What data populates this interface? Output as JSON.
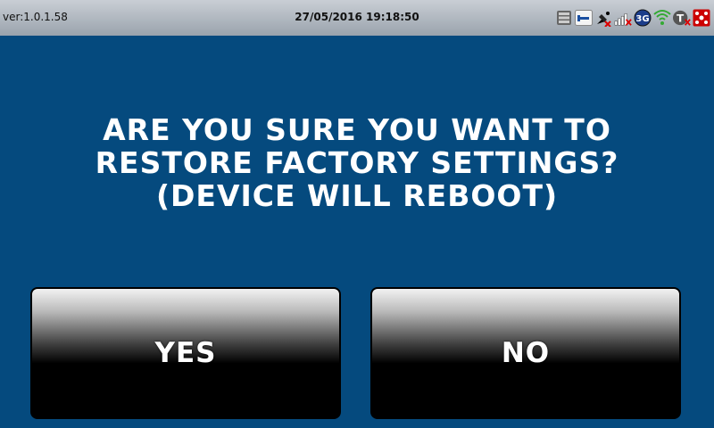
{
  "status_bar": {
    "version": "ver:1.0.1.58",
    "datetime": "27/05/2016 19:18:50",
    "icons": [
      "storage-icon",
      "network-icon",
      "satellite-off-icon",
      "signal-off-icon",
      "3g-icon",
      "wifi-icon",
      "telnet-off-icon",
      "alarm-icon"
    ],
    "network_badge": "3G",
    "telnet_badge": "T"
  },
  "dialog": {
    "message_lines": [
      "ARE YOU SURE YOU WANT TO",
      "RESTORE FACTORY SETTINGS?",
      "(DEVICE WILL REBOOT)"
    ],
    "yes_label": "YES",
    "no_label": "NO"
  },
  "colors": {
    "background": "#054a7e",
    "statusbar": "#b0b7bf",
    "text": "#ffffff"
  }
}
